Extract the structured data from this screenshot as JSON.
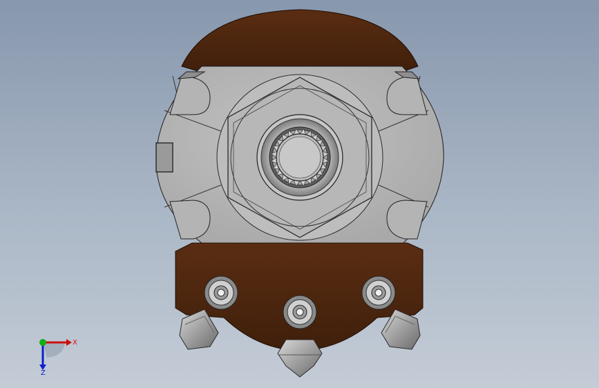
{
  "viewport": {
    "background_top": "#8797ad",
    "background_bottom": "#c4ccd6"
  },
  "model": {
    "body_color": "#4a2510",
    "face_color": "#b8b8b8",
    "edge_color": "#202020",
    "pin_color": "#a8a8a8"
  },
  "triad": {
    "x_label": "X",
    "z_label": "Z",
    "x_color": "#cc1010",
    "y_color": "#10b010",
    "z_color": "#1020cc"
  }
}
